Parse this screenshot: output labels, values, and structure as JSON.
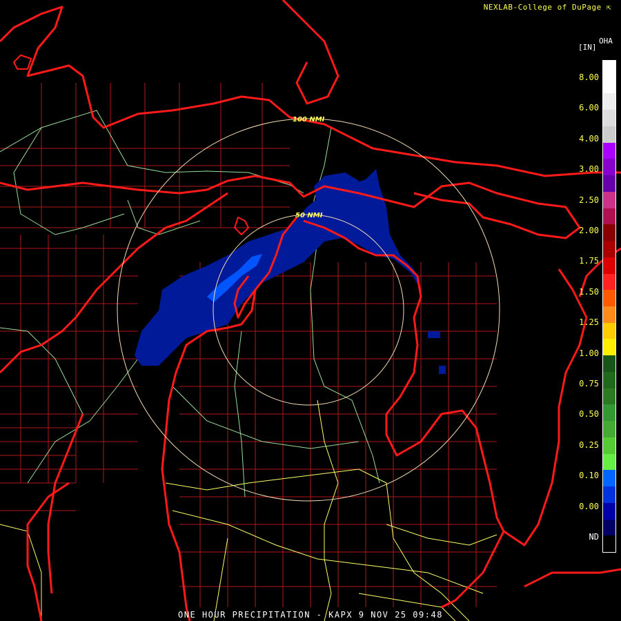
{
  "header": {
    "credit": "NEXLAB-College of DuPage",
    "credit_mark": "⇱"
  },
  "footer": {
    "caption": "ONE HOUR PRECIPITATION - KAPX 9 NOV 25 09:48"
  },
  "legend": {
    "unit": "[IN]",
    "product": "OHA",
    "labels": [
      "ND",
      "0.00",
      "0.10",
      "0.25",
      "0.50",
      "0.75",
      "1.00",
      "1.25",
      "1.50",
      "1.75",
      "2.00",
      "2.50",
      "3.00",
      "4.00",
      "6.00",
      "8.00"
    ],
    "colors": [
      "#000000",
      "#000066",
      "#0000aa",
      "#0033dd",
      "#0066ff",
      "#66ee44",
      "#55cc33",
      "#44aa33",
      "#339933",
      "#2a7a22",
      "#1f6a1a",
      "#185518",
      "#ffee00",
      "#ffcc00",
      "#ff8c1a",
      "#ff5a00",
      "#ff2222",
      "#dd0000",
      "#aa0000",
      "#880000",
      "#b01050",
      "#cc3388",
      "#6600aa",
      "#8800cc",
      "#aa00ff",
      "#cccccc",
      "#dddddd",
      "#eeeeee",
      "#ffffff",
      "#ffffff"
    ]
  },
  "rings": {
    "inner_label": "50 NMI",
    "outer_label": "100 NMI"
  },
  "colors": {
    "coastline": "#ff1a1a",
    "county_line": "#b01818",
    "highway_primary": "#ffff66",
    "highway_secondary": "#99dd99",
    "range_ring": "#f5deb3",
    "precip_light": "#001a99",
    "precip_mod": "#0055ff"
  }
}
